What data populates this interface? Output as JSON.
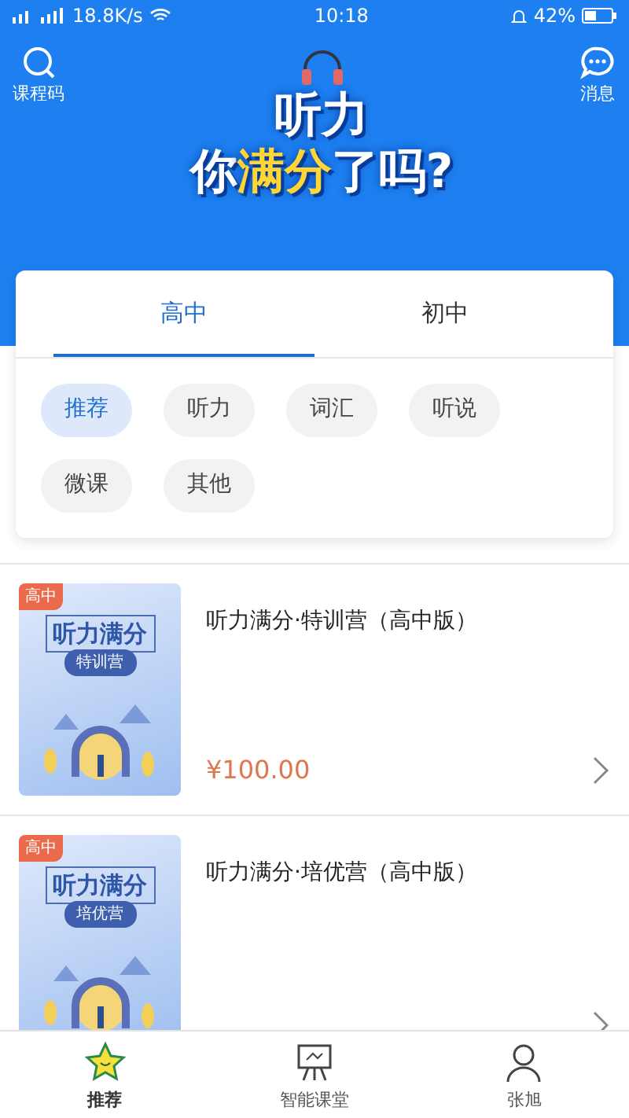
{
  "status_bar": {
    "network_speed": "18.8K/s",
    "time": "10:18",
    "battery": "42%"
  },
  "header": {
    "left_action": "课程码",
    "right_action": "消息"
  },
  "banner": {
    "line_1": [
      {
        "text": "听力",
        "highlight": false
      }
    ],
    "line_2": [
      {
        "text": "你",
        "highlight": false
      },
      {
        "text": "满分",
        "highlight": true
      },
      {
        "text": "了吗?",
        "highlight": false
      }
    ]
  },
  "tabs": [
    {
      "label": "高中",
      "selected": true
    },
    {
      "label": "初中",
      "selected": false
    }
  ],
  "chips": [
    {
      "label": "推荐",
      "selected": true
    },
    {
      "label": "听力",
      "selected": false
    },
    {
      "label": "词汇",
      "selected": false
    },
    {
      "label": "听说",
      "selected": false
    },
    {
      "label": "微课",
      "selected": false
    },
    {
      "label": "其他",
      "selected": false
    }
  ],
  "courses": [
    {
      "tag": "高中",
      "cover_title": "听力满分",
      "cover_subtitle": "特训营",
      "title": "听力满分·特训营（高中版）",
      "price": "¥100.00"
    },
    {
      "tag": "高中",
      "cover_title": "听力满分",
      "cover_subtitle": "培优营",
      "title": "听力满分·培优营（高中版）"
    }
  ],
  "bottom_nav": [
    {
      "label": "推荐",
      "kind": "star",
      "selected": true
    },
    {
      "label": "智能课堂",
      "kind": "board",
      "selected": false
    },
    {
      "label": "张旭",
      "kind": "person",
      "selected": false
    }
  ]
}
